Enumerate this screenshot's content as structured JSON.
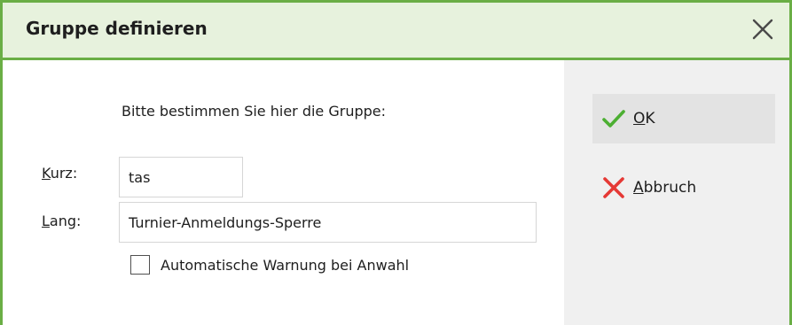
{
  "window": {
    "title": "Gruppe definieren",
    "accent_color": "#6aae45",
    "titlebar_background": "#e7f2dd"
  },
  "form": {
    "prompt": "Bitte bestimmen Sie hier die Gruppe:",
    "kurz": {
      "label": "Kurz:",
      "value": "tas"
    },
    "lang": {
      "label": "Lang:",
      "value": "Turnier-Anmeldungs-Sperre"
    },
    "checkbox": {
      "label": "Automatische Warnung bei Anwahl",
      "checked": false
    }
  },
  "buttons": {
    "ok": {
      "label": "OK",
      "icon": "checkmark-icon",
      "icon_color": "#4caf32"
    },
    "cancel": {
      "label": "Abbruch",
      "icon": "cross-icon",
      "icon_color": "#e53935"
    },
    "close": {
      "icon": "close-icon"
    }
  }
}
